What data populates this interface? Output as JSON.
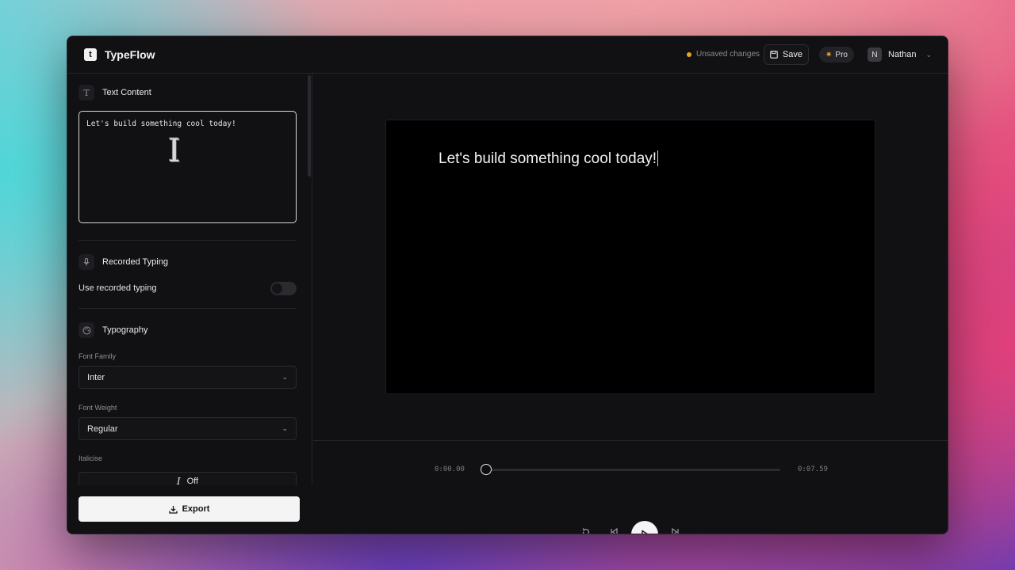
{
  "header": {
    "app_name": "TypeFlow",
    "logo_letter": "t",
    "unsaved_text": "Unsaved changes",
    "save_label": "Save",
    "pro_label": "Pro",
    "user_initial": "N",
    "user_name": "Nathan",
    "colors": {
      "unsaved_dot": "#e6a52a"
    }
  },
  "sidebar": {
    "text_content": {
      "title": "Text Content",
      "value": "Let's build something cool today!"
    },
    "recorded_typing": {
      "title": "Recorded Typing",
      "toggle_label": "Use recorded typing",
      "toggle_on": false
    },
    "typography": {
      "title": "Typography",
      "font_family_label": "Font Family",
      "font_family_value": "Inter",
      "font_weight_label": "Font Weight",
      "font_weight_value": "Regular",
      "italicise_label": "Italicise",
      "italicise_value": "Off"
    },
    "export_label": "Export"
  },
  "preview": {
    "text": "Let's build something cool today!"
  },
  "timeline": {
    "current_time": "0:00.00",
    "total_time": "0:07.59",
    "progress": 0.0
  }
}
